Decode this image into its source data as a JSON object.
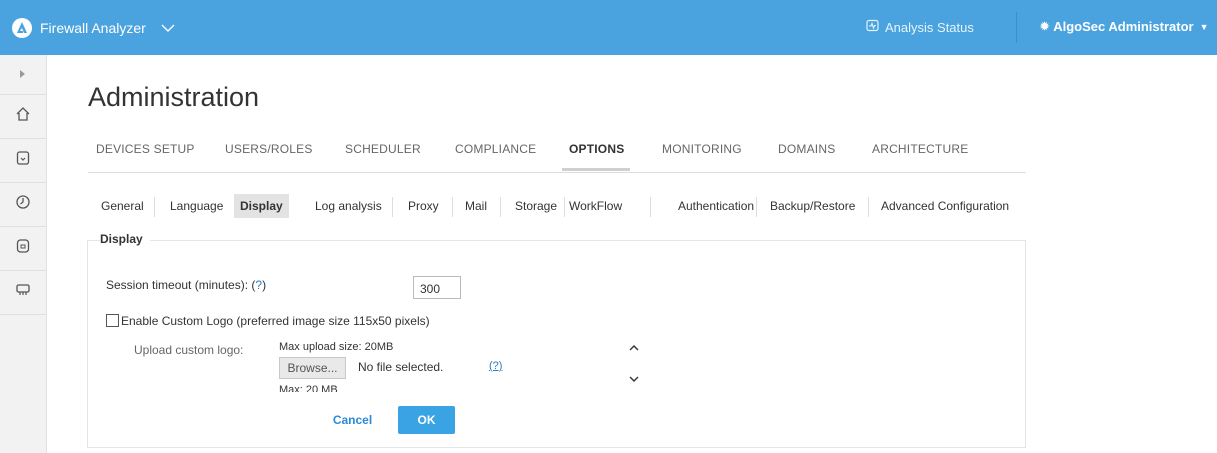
{
  "topbar": {
    "app_name": "Firewall Analyzer",
    "analysis_status": "Analysis Status",
    "user": "AlgoSec Administrator",
    "bg_color": "#4aa3df"
  },
  "sidebar": {
    "items": [
      "expand-icon",
      "home-icon",
      "device-icon",
      "history-icon",
      "policy-icon",
      "network-icon"
    ]
  },
  "page": {
    "title": "Administration"
  },
  "tabs": [
    "DEVICES SETUP",
    "USERS/ROLES",
    "SCHEDULER",
    "COMPLIANCE",
    "OPTIONS",
    "MONITORING",
    "DOMAINS",
    "ARCHITECTURE"
  ],
  "active_tab": "OPTIONS",
  "subtabs": [
    "General",
    "Language",
    "Display",
    "Log analysis",
    "Proxy",
    "Mail",
    "Storage",
    "WorkFlow",
    "Authentication",
    "Backup/Restore",
    "Advanced Configuration"
  ],
  "active_subtab": "Display",
  "display": {
    "legend": "Display",
    "session_timeout_label": "Session timeout (minutes): (",
    "session_timeout_help": "?",
    "session_timeout_close": ")",
    "session_timeout_value": "300",
    "custom_logo_label": "Enable Custom Logo (preferred image size 115x50 pixels)",
    "custom_logo_checked": false,
    "upload_label": "Upload custom logo:",
    "max_upload": "Max upload size: 20MB",
    "browse": "Browse...",
    "no_file": "No file selected.",
    "upload_help": "(?)",
    "max_note": "Max: 20 MB"
  },
  "buttons": {
    "cancel": "Cancel",
    "ok": "OK"
  }
}
